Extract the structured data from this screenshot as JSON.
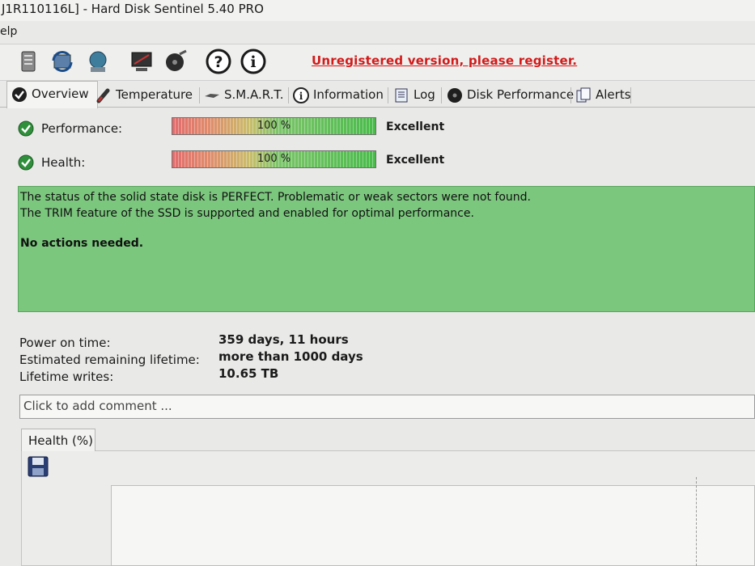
{
  "window": {
    "title": "J1R110116L]  -  Hard Disk Sentinel 5.40 PRO",
    "menu": "elp"
  },
  "toolbar": {
    "register_link": "Unregistered version, please register.",
    "icons": [
      "disk-report-icon",
      "refresh-icon",
      "network-icon",
      "monitor-icon",
      "disk-test-icon",
      "help-icon",
      "info-icon"
    ]
  },
  "tabs": [
    {
      "label": "Overview",
      "icon": "check-circle-icon"
    },
    {
      "label": "Temperature",
      "icon": "thermometer-icon"
    },
    {
      "label": "S.M.A.R.T.",
      "icon": "smart-icon"
    },
    {
      "label": "Information",
      "icon": "info-icon"
    },
    {
      "label": "Log",
      "icon": "log-icon"
    },
    {
      "label": "Disk Performance",
      "icon": "performance-icon"
    },
    {
      "label": "Alerts",
      "icon": "alerts-icon"
    }
  ],
  "status": {
    "performance": {
      "label": "Performance:",
      "value_text": "100 %",
      "value": 100,
      "rating": "Excellent"
    },
    "health": {
      "label": "Health:",
      "value_text": "100 %",
      "value": 100,
      "rating": "Excellent"
    }
  },
  "message": {
    "line1": "The status of the solid state disk is PERFECT. Problematic or weak sectors were not found.",
    "line2": "The TRIM feature of the SSD is supported and enabled for optimal performance.",
    "action": "No actions needed."
  },
  "info": {
    "power_on_label": "Power on time:",
    "power_on_value": "359 days, 11 hours",
    "lifetime_label": "Estimated remaining lifetime:",
    "lifetime_value": "more than 1000 days",
    "writes_label": "Lifetime writes:",
    "writes_value": "10.65 TB"
  },
  "comment": {
    "placeholder": "Click to add comment ..."
  },
  "health_chart": {
    "tab_label": "Health (%)"
  },
  "colors": {
    "status_green": "#7cc77e",
    "register_red": "#d21a1a",
    "check_green": "#2f8f3a"
  }
}
